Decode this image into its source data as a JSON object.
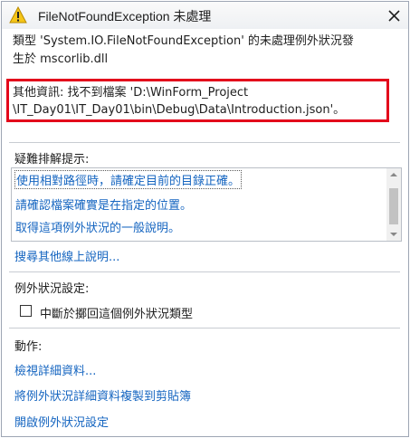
{
  "dialog": {
    "title": "FileNotFoundException 未處理",
    "message_line1": "類型 'System.IO.FileNotFoundException' 的未處理例外狀況發",
    "message_line2": "生於 mscorlib.dll",
    "info_line1": "其他資訊: 找不到檔案 'D:\\WinForm_Project",
    "info_line2": "\\IT_Day01\\IT_Day01\\bin\\Debug\\Data\\Introduction.json'。"
  },
  "troubleshooting": {
    "title": "疑難排解提示:",
    "tips": [
      "使用相對路徑時，請確定目前的目錄正確。",
      "請確認檔案確實是在指定的位置。",
      "取得這項例外狀況的一般說明。"
    ],
    "more_help": "搜尋其他線上說明..."
  },
  "exception_settings": {
    "title": "例外狀況設定:",
    "break_checkbox_label": "中斷於擲回這個例外狀況類型",
    "checked": false
  },
  "actions": {
    "title": "動作:",
    "items": [
      "檢視詳細資料...",
      "將例外狀況詳細資料複製到剪貼簿",
      "開啟例外狀況設定"
    ]
  },
  "colors": {
    "link": "#1565c0",
    "highlight_border": "#e3061b",
    "warning": "#f5c518"
  },
  "icons": {
    "title_icon": "warning-icon",
    "close": "close-icon"
  }
}
